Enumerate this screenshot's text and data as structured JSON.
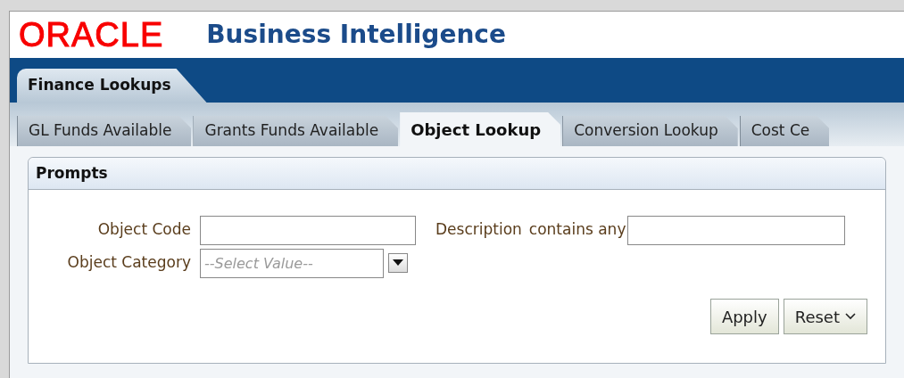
{
  "header": {
    "logo": "ORACLE",
    "product": "Business Intelligence"
  },
  "dashboard_tabs": [
    {
      "label": "Finance Lookups",
      "selected": true
    }
  ],
  "page_tabs": [
    {
      "label": "GL Funds Available",
      "selected": false
    },
    {
      "label": "Grants Funds Available",
      "selected": false
    },
    {
      "label": "Object Lookup",
      "selected": true
    },
    {
      "label": "Conversion Lookup",
      "selected": false
    },
    {
      "label": "Cost Ce",
      "selected": false
    }
  ],
  "prompts": {
    "title": "Prompts",
    "object_code": {
      "label": "Object Code"
    },
    "description": {
      "label": "Description",
      "operator": "contains any"
    },
    "object_category": {
      "label": "Object Category",
      "placeholder": "--Select Value--"
    },
    "buttons": [
      {
        "label": "Apply",
        "kind": "plain"
      },
      {
        "label": "Reset",
        "kind": "menu"
      }
    ]
  }
}
